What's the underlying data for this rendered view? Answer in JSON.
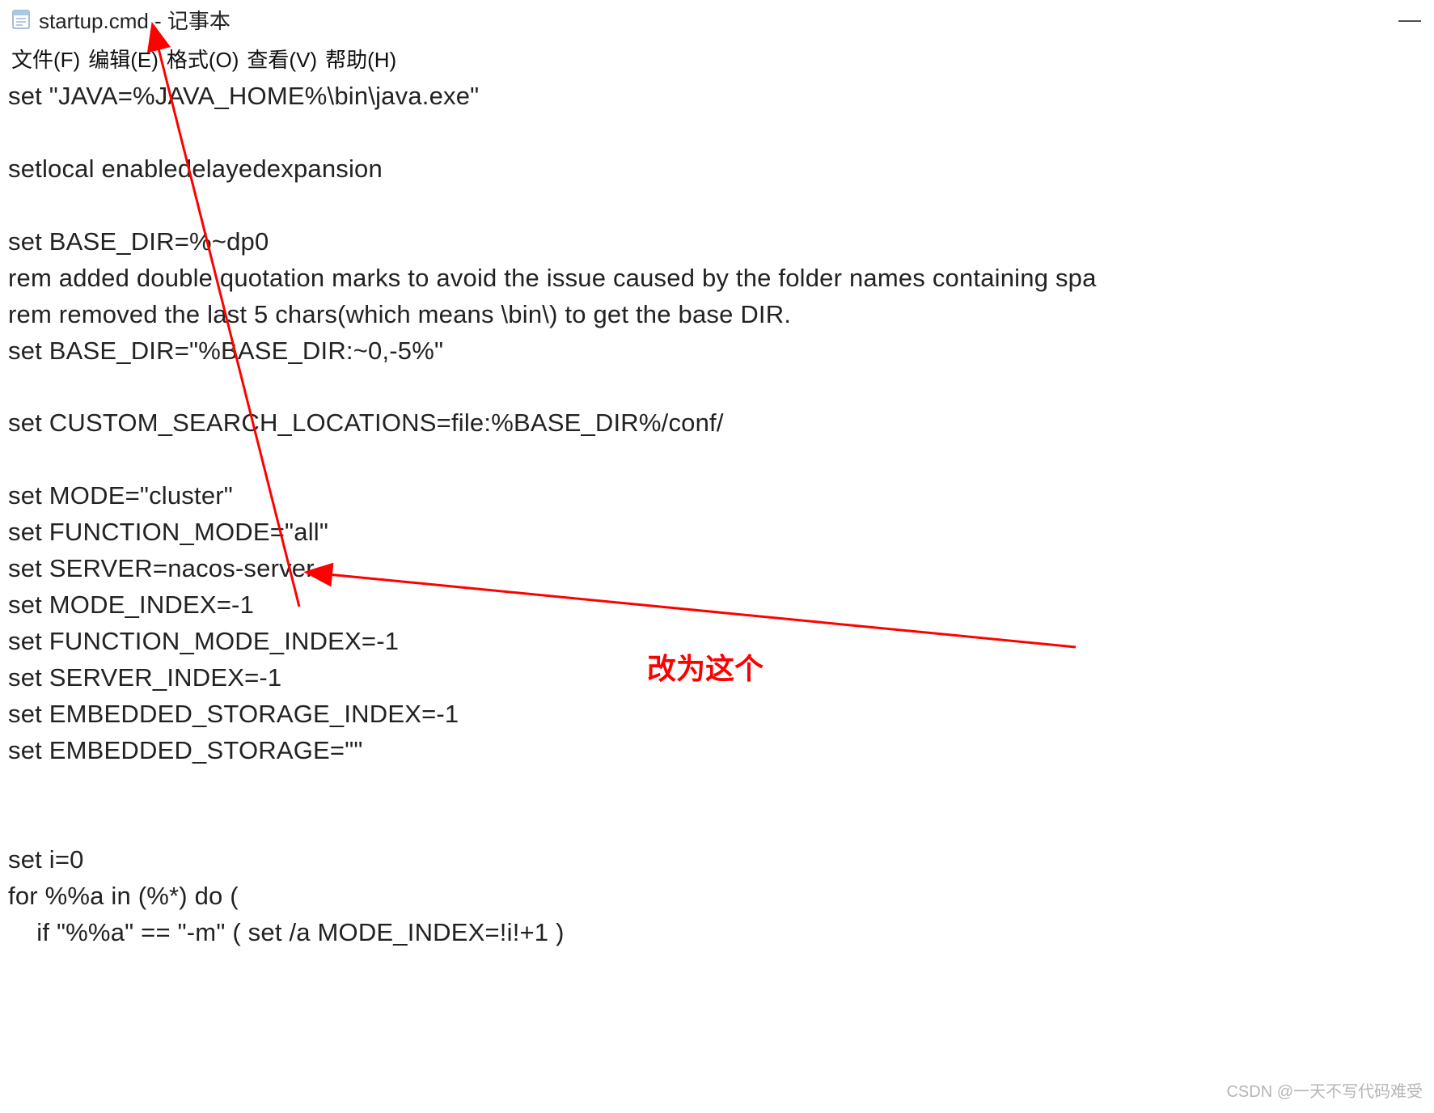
{
  "window": {
    "title": "startup.cmd - 记事本",
    "icon_name": "notepad-icon"
  },
  "menubar": {
    "file": "文件(F)",
    "edit": "编辑(E)",
    "format": "格式(O)",
    "view": "查看(V)",
    "help": "帮助(H)"
  },
  "editor": {
    "lines": [
      "set \"JAVA=%JAVA_HOME%\\bin\\java.exe\"",
      "",
      "setlocal enabledelayedexpansion",
      "",
      "set BASE_DIR=%~dp0",
      "rem added double quotation marks to avoid the issue caused by the folder names containing spa",
      "rem removed the last 5 chars(which means \\bin\\) to get the base DIR.",
      "set BASE_DIR=\"%BASE_DIR:~0,-5%\"",
      "",
      "set CUSTOM_SEARCH_LOCATIONS=file:%BASE_DIR%/conf/",
      "",
      "set MODE=\"cluster\"",
      "set FUNCTION_MODE=\"all\"",
      "set SERVER=nacos-server",
      "set MODE_INDEX=-1",
      "set FUNCTION_MODE_INDEX=-1",
      "set SERVER_INDEX=-1",
      "set EMBEDDED_STORAGE_INDEX=-1",
      "set EMBEDDED_STORAGE=\"\"",
      "",
      "",
      "set i=0",
      "for %%a in (%*) do (",
      "    if \"%%a\" == \"-m\" ( set /a MODE_INDEX=!i!+1 )"
    ]
  },
  "annotations": {
    "label": "改为这个",
    "color": "#ff0000"
  },
  "watermark": "CSDN @一天不写代码难受"
}
